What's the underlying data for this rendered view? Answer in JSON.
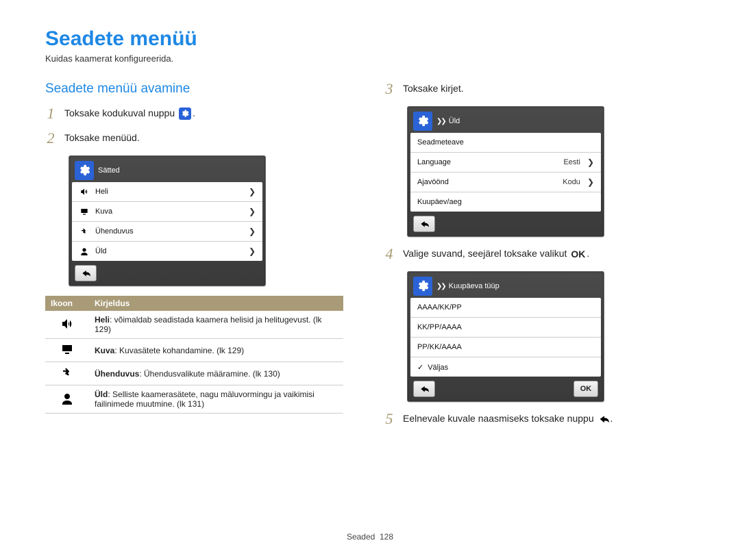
{
  "page_title": "Seadete menüü",
  "caption": "Kuidas kaamerat konfigureerida.",
  "section_heading": "Seadete menüü avamine",
  "footer": {
    "label": "Seaded",
    "page": "128"
  },
  "steps": {
    "1": {
      "text_before": "Toksake kodukuval nuppu ",
      "text_after": "."
    },
    "2": {
      "text": "Toksake menüüd."
    },
    "3": {
      "text": "Toksake kirjet."
    },
    "4": {
      "text_before": "Valige suvand, seejärel toksake valikut ",
      "text_after": "."
    },
    "5": {
      "text_before": "Eelnevale kuvale naasmiseks toksake nuppu ",
      "text_after": "."
    }
  },
  "device1": {
    "title": "Sätted",
    "rows": [
      {
        "label": "Heli"
      },
      {
        "label": "Kuva"
      },
      {
        "label": "Ühenduvus"
      },
      {
        "label": "Üld"
      }
    ]
  },
  "device2": {
    "crumb": "Üld",
    "rows": [
      {
        "label": "Seadmeteave"
      },
      {
        "label": "Language",
        "right": "Eesti"
      },
      {
        "label": "Ajavöönd",
        "right": "Kodu"
      },
      {
        "label": "Kuupäev/aeg"
      }
    ]
  },
  "device3": {
    "crumb": "Kuupäeva tüüp",
    "rows": [
      {
        "label": "AAAA/KK/PP"
      },
      {
        "label": "KK/PP/AAAA"
      },
      {
        "label": "PP/KK/AAAA"
      },
      {
        "label": "Väljas",
        "checked": true
      }
    ],
    "ok_label": "OK"
  },
  "desc_table": {
    "headers": [
      "Ikoon",
      "Kirjeldus"
    ],
    "rows": [
      {
        "term": "Heli",
        "desc": ": võimaldab seadistada kaamera helisid ja helitugevust. (lk 129)"
      },
      {
        "term": "Kuva",
        "desc": ": Kuvasätete kohandamine. (lk 129)"
      },
      {
        "term": "Ühenduvus",
        "desc": ": Ühendusvalikute määramine. (lk 130)"
      },
      {
        "term": "Üld",
        "desc": ": Selliste kaamerasätete, nagu mäluvormingu ja vaikimisi failinimede muutmine. (lk 131)"
      }
    ]
  }
}
